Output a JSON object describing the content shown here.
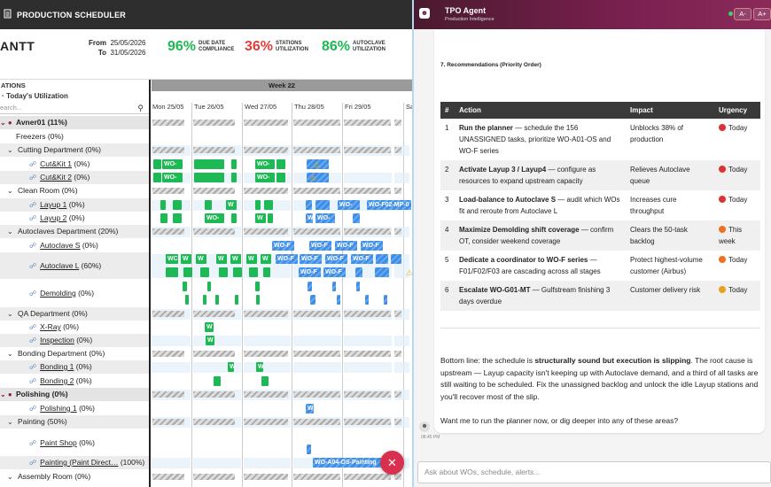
{
  "topbar": {
    "title": "PRODUCTION SCHEDULER"
  },
  "header": {
    "title": "ANTT",
    "from_label": "From",
    "from": "25/05/2026",
    "to_label": "To",
    "to": "31/05/2026",
    "kpis": [
      {
        "value": "96%",
        "label1": "DUE DATE",
        "label2": "COMPLIANCE",
        "color": "#1db954"
      },
      {
        "value": "36%",
        "label1": "STATIONS",
        "label2": "UTILIZATION",
        "color": "#e23b3b"
      },
      {
        "value": "86%",
        "label1": "AUTOCLAVE",
        "label2": "UTILIZATION",
        "color": "#1db954"
      }
    ]
  },
  "left": {
    "heading": "ATIONS",
    "today": "Today's Utilization",
    "search_placeholder": "earch..."
  },
  "tree": [
    {
      "label": "Avner01 (11%)",
      "level": 0,
      "type": "grp"
    },
    {
      "label": "Freezers (0%)",
      "level": 1
    },
    {
      "label": "Cutting Department (0%)",
      "level": 1,
      "g": true
    },
    {
      "label": "Cut&Kit 1 (0%)",
      "level": 2,
      "link": "Cut&Kit 1",
      "rest": " (0%)"
    },
    {
      "label": "Cut&Kit 2 (0%)",
      "level": 2,
      "link": "Cut&Kit 2",
      "rest": " (0%)",
      "g": true
    },
    {
      "label": "Clean Room (0%)",
      "level": 1
    },
    {
      "label": "Layup 1 (0%)",
      "level": 2,
      "link": "Layup 1",
      "rest": " (0%)",
      "g": true
    },
    {
      "label": "Layup 2 (0%)",
      "level": 2,
      "link": "Layup 2",
      "rest": " (0%)"
    },
    {
      "label": "Autoclaves Department (20%)",
      "level": 1,
      "g": true
    },
    {
      "label": "Autoclave S (0%)",
      "level": 2,
      "link": "Autoclave S",
      "rest": " (0%)"
    },
    {
      "label": "Autoclave L (60%)",
      "level": 2,
      "link": "Autoclave L",
      "rest": " (60%)",
      "g": true
    },
    {
      "label": "Demolding (0%)",
      "level": 2,
      "link": "Demolding",
      "rest": " (0%)"
    },
    {
      "label": "QA Department (0%)",
      "level": 1,
      "g": true
    },
    {
      "label": "X-Ray (0%)",
      "level": 2,
      "link": "X-Ray",
      "rest": " (0%)"
    },
    {
      "label": "Inspection (0%)",
      "level": 2,
      "link": "Inspection",
      "rest": " (0%)",
      "g": true
    },
    {
      "label": "Bonding Department (0%)",
      "level": 1
    },
    {
      "label": "Bonding 1 (0%)",
      "level": 2,
      "link": "Bonding 1",
      "rest": " (0%)",
      "g": true
    },
    {
      "label": "Bonding 2 (0%)",
      "level": 2,
      "link": "Bonding 2",
      "rest": " (0%)"
    },
    {
      "label": "Polishing (0%)",
      "level": 0,
      "type": "grp"
    },
    {
      "label": "Polishing 1 (0%)",
      "level": 2,
      "link": "Polishing 1",
      "rest": " (0%)"
    },
    {
      "label": "Painting (50%)",
      "level": 1,
      "g": true
    },
    {
      "label": "Paint Shop (0%)",
      "level": 2,
      "link": "Paint Shop",
      "rest": " (0%)"
    },
    {
      "label": "Painting (Paint Direct… (100%)",
      "level": 2,
      "link": "Painting (Paint Direct…",
      "rest": " (100%)",
      "g": true
    },
    {
      "label": "Assembly Room (0%)",
      "level": 1
    }
  ],
  "gantt": {
    "week": "Week 22",
    "days": [
      "Mon 25/05",
      "Tue 26/05",
      "Wed 27/05",
      "Thu 28/05",
      "Fri 29/05",
      "Sa"
    ],
    "bar_labels": {
      "wo": "WO-",
      "wof": "WO-F",
      "wof02": "WO-F02-MP-0",
      "wo_a04": "WO-A04-OS-Painting",
      "wc": "WC",
      "w": "W"
    }
  },
  "agent": {
    "name": "TPO Agent",
    "subtitle": "Production Intelligence",
    "font_minus": "A-",
    "font_plus": "A+",
    "section": "7. Recommendations (Priority Order)",
    "columns": [
      "#",
      "Action",
      "Impact",
      "Urgency"
    ],
    "rows": [
      {
        "n": "1",
        "bold": "Run the planner",
        "rest": " — schedule the 156 UNASSIGNED tasks, prioritize WO-A01-OS and WO-F series",
        "impact": "Unblocks 38% of production",
        "urgency": "Today",
        "uc": "red"
      },
      {
        "n": "2",
        "bold": "Activate Layup 3 / Layup4",
        "rest": " — configure as resources to expand upstream capacity",
        "impact": "Relieves Autoclave queue",
        "urgency": "Today",
        "uc": "red"
      },
      {
        "n": "3",
        "bold": "Load-balance to Autoclave S",
        "rest": " — audit which WOs fit and reroute from Autoclave L",
        "impact": "Increases cure throughput",
        "urgency": "Today",
        "uc": "red"
      },
      {
        "n": "4",
        "bold": "Maximize Demolding shift coverage",
        "rest": " — confirm OT, consider weekend coverage",
        "impact": "Clears the 50-task backlog",
        "urgency": "This week",
        "uc": "org"
      },
      {
        "n": "5",
        "bold": "Dedicate a coordinator to WO-F series",
        "rest": " — F01/F02/F03 are cascading across all stages",
        "impact": "Protect highest-volume customer (Airbus)",
        "urgency": "Today",
        "uc": "org"
      },
      {
        "n": "6",
        "bold": "Escalate WO-G01-MT",
        "rest": " — Gulfstream finishing 3 days overdue",
        "impact": "Customer delivery risk",
        "urgency": "Today",
        "uc": "yel"
      }
    ],
    "bottom_pre": "Bottom line: the schedule is ",
    "bottom_bold": "structurally sound but execution is slipping",
    "bottom_post": ". The root cause is upstream — Layup capacity isn't keeping up with Autoclave demand, and a third of all tasks are still waiting to be scheduled. Fix the unassigned backlog and unlock the idle Layup stations and you'll recover most of the slip.",
    "ask": "Want me to run the planner now, or dig deeper into any of these areas?",
    "time": "08:45 PM",
    "input_placeholder": "Ask about WOs, schedule, alerts..."
  },
  "colors": {
    "green": "#1db954",
    "red": "#e23b3b",
    "blue": "#3d8ee8",
    "header_dark": "#2e2e2e"
  }
}
